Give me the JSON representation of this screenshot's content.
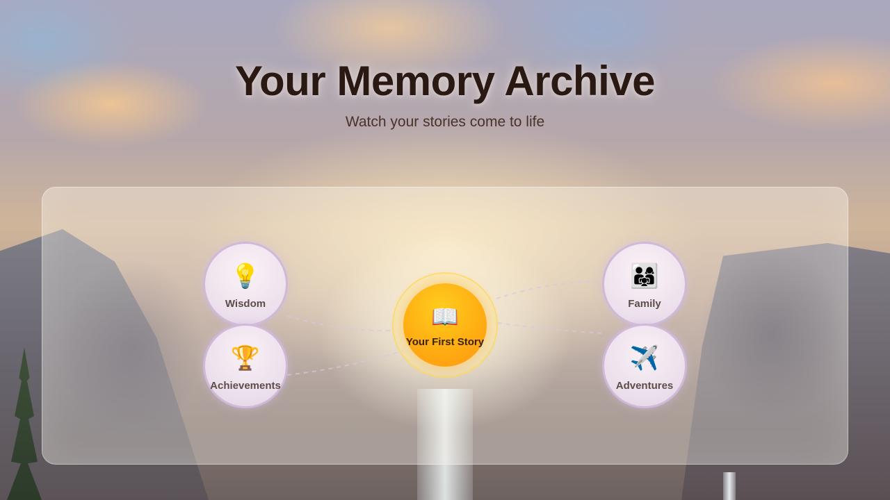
{
  "header": {
    "title": "Your Memory Archive",
    "subtitle": "Watch your stories come to life"
  },
  "center": {
    "label": "Your First Story",
    "icon": "open-book-icon",
    "glyph": "📖",
    "color": "#ffae12"
  },
  "nodes": [
    {
      "id": "wisdom",
      "label": "Wisdom",
      "icon": "lightbulb-icon",
      "glyph": "💡"
    },
    {
      "id": "achievements",
      "label": "Achievements",
      "icon": "trophy-icon",
      "glyph": "🏆"
    },
    {
      "id": "family",
      "label": "Family",
      "icon": "family-icon",
      "glyph": "👨‍👩‍👧"
    },
    {
      "id": "adventures",
      "label": "Adventures",
      "icon": "airplane-icon",
      "glyph": "✈️"
    }
  ]
}
